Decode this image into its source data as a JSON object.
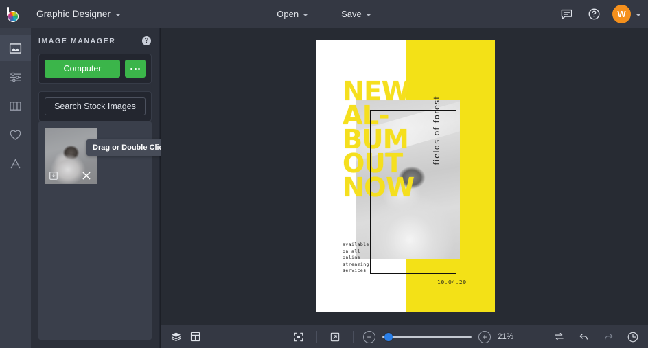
{
  "topbar": {
    "logo_icon": "bedesigner-logo-icon",
    "app_title": "Graphic Designer",
    "open_label": "Open",
    "save_label": "Save",
    "chat_icon": "chat-bubble-icon",
    "help_icon": "help-circle-icon",
    "avatar_initial": "W"
  },
  "rail": {
    "items": [
      {
        "icon": "image-icon",
        "name": "sidebar-item-images",
        "active": true
      },
      {
        "icon": "sliders-icon",
        "name": "sidebar-item-adjustments",
        "active": false
      },
      {
        "icon": "columns-icon",
        "name": "sidebar-item-layouts",
        "active": false
      },
      {
        "icon": "heart-icon",
        "name": "sidebar-item-favorites",
        "active": false
      },
      {
        "icon": "text-a-icon",
        "name": "sidebar-item-text",
        "active": false
      }
    ]
  },
  "panel": {
    "title": "IMAGE MANAGER",
    "help_icon": "help-circle-icon",
    "help_label": "?",
    "computer_button": "Computer",
    "more_button_icon": "ellipsis-icon",
    "stock_button": "Search Stock Images",
    "thumbnail": {
      "tooltip": "Drag or Double Click",
      "import_icon": "import-image-icon",
      "remove_icon": "close-x-icon"
    }
  },
  "canvas": {
    "artwork": {
      "headline": "NEW\nAL-\nBUM\nOUT\nNOW",
      "vertical_text": "fields of forest",
      "small_text": "available\non all\nonline\nstreaming\nservices",
      "date": "10.04.20",
      "background_color": "#f3e117",
      "headline_color": "#f5df1e",
      "paper_color": "#ffffff"
    }
  },
  "bottombar": {
    "layers_icon": "layers-icon",
    "pages_icon": "page-layout-icon",
    "fit_icon": "fit-to-screen-icon",
    "fullscreen_icon": "expand-arrow-icon",
    "zoom_out_icon": "minus-icon",
    "zoom_out_label": "−",
    "zoom_in_icon": "plus-icon",
    "zoom_in_label": "+",
    "zoom_level": "21%",
    "compare_icon": "swap-arrows-icon",
    "undo_icon": "undo-arrow-icon",
    "redo_icon": "redo-arrow-icon",
    "history_icon": "history-clock-icon"
  }
}
